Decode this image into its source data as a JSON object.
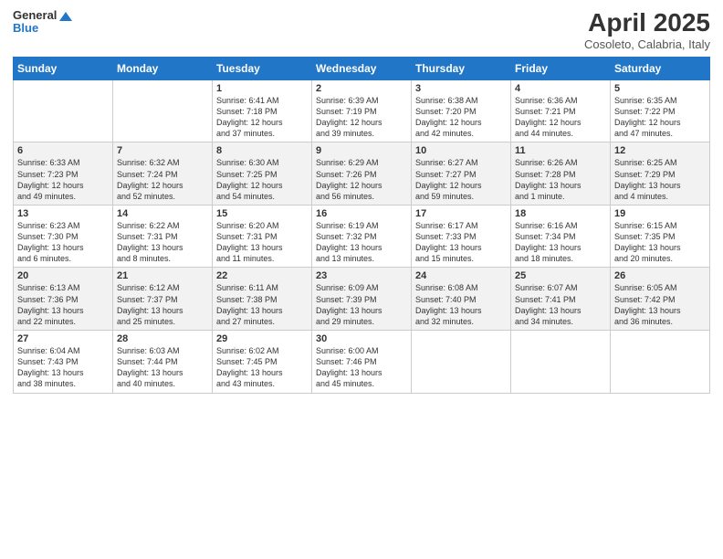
{
  "header": {
    "logo_line1": "General",
    "logo_line2": "Blue",
    "month": "April 2025",
    "location": "Cosoleto, Calabria, Italy"
  },
  "weekdays": [
    "Sunday",
    "Monday",
    "Tuesday",
    "Wednesday",
    "Thursday",
    "Friday",
    "Saturday"
  ],
  "weeks": [
    [
      {
        "day": "",
        "info": ""
      },
      {
        "day": "",
        "info": ""
      },
      {
        "day": "1",
        "info": "Sunrise: 6:41 AM\nSunset: 7:18 PM\nDaylight: 12 hours\nand 37 minutes."
      },
      {
        "day": "2",
        "info": "Sunrise: 6:39 AM\nSunset: 7:19 PM\nDaylight: 12 hours\nand 39 minutes."
      },
      {
        "day": "3",
        "info": "Sunrise: 6:38 AM\nSunset: 7:20 PM\nDaylight: 12 hours\nand 42 minutes."
      },
      {
        "day": "4",
        "info": "Sunrise: 6:36 AM\nSunset: 7:21 PM\nDaylight: 12 hours\nand 44 minutes."
      },
      {
        "day": "5",
        "info": "Sunrise: 6:35 AM\nSunset: 7:22 PM\nDaylight: 12 hours\nand 47 minutes."
      }
    ],
    [
      {
        "day": "6",
        "info": "Sunrise: 6:33 AM\nSunset: 7:23 PM\nDaylight: 12 hours\nand 49 minutes."
      },
      {
        "day": "7",
        "info": "Sunrise: 6:32 AM\nSunset: 7:24 PM\nDaylight: 12 hours\nand 52 minutes."
      },
      {
        "day": "8",
        "info": "Sunrise: 6:30 AM\nSunset: 7:25 PM\nDaylight: 12 hours\nand 54 minutes."
      },
      {
        "day": "9",
        "info": "Sunrise: 6:29 AM\nSunset: 7:26 PM\nDaylight: 12 hours\nand 56 minutes."
      },
      {
        "day": "10",
        "info": "Sunrise: 6:27 AM\nSunset: 7:27 PM\nDaylight: 12 hours\nand 59 minutes."
      },
      {
        "day": "11",
        "info": "Sunrise: 6:26 AM\nSunset: 7:28 PM\nDaylight: 13 hours\nand 1 minute."
      },
      {
        "day": "12",
        "info": "Sunrise: 6:25 AM\nSunset: 7:29 PM\nDaylight: 13 hours\nand 4 minutes."
      }
    ],
    [
      {
        "day": "13",
        "info": "Sunrise: 6:23 AM\nSunset: 7:30 PM\nDaylight: 13 hours\nand 6 minutes."
      },
      {
        "day": "14",
        "info": "Sunrise: 6:22 AM\nSunset: 7:31 PM\nDaylight: 13 hours\nand 8 minutes."
      },
      {
        "day": "15",
        "info": "Sunrise: 6:20 AM\nSunset: 7:31 PM\nDaylight: 13 hours\nand 11 minutes."
      },
      {
        "day": "16",
        "info": "Sunrise: 6:19 AM\nSunset: 7:32 PM\nDaylight: 13 hours\nand 13 minutes."
      },
      {
        "day": "17",
        "info": "Sunrise: 6:17 AM\nSunset: 7:33 PM\nDaylight: 13 hours\nand 15 minutes."
      },
      {
        "day": "18",
        "info": "Sunrise: 6:16 AM\nSunset: 7:34 PM\nDaylight: 13 hours\nand 18 minutes."
      },
      {
        "day": "19",
        "info": "Sunrise: 6:15 AM\nSunset: 7:35 PM\nDaylight: 13 hours\nand 20 minutes."
      }
    ],
    [
      {
        "day": "20",
        "info": "Sunrise: 6:13 AM\nSunset: 7:36 PM\nDaylight: 13 hours\nand 22 minutes."
      },
      {
        "day": "21",
        "info": "Sunrise: 6:12 AM\nSunset: 7:37 PM\nDaylight: 13 hours\nand 25 minutes."
      },
      {
        "day": "22",
        "info": "Sunrise: 6:11 AM\nSunset: 7:38 PM\nDaylight: 13 hours\nand 27 minutes."
      },
      {
        "day": "23",
        "info": "Sunrise: 6:09 AM\nSunset: 7:39 PM\nDaylight: 13 hours\nand 29 minutes."
      },
      {
        "day": "24",
        "info": "Sunrise: 6:08 AM\nSunset: 7:40 PM\nDaylight: 13 hours\nand 32 minutes."
      },
      {
        "day": "25",
        "info": "Sunrise: 6:07 AM\nSunset: 7:41 PM\nDaylight: 13 hours\nand 34 minutes."
      },
      {
        "day": "26",
        "info": "Sunrise: 6:05 AM\nSunset: 7:42 PM\nDaylight: 13 hours\nand 36 minutes."
      }
    ],
    [
      {
        "day": "27",
        "info": "Sunrise: 6:04 AM\nSunset: 7:43 PM\nDaylight: 13 hours\nand 38 minutes."
      },
      {
        "day": "28",
        "info": "Sunrise: 6:03 AM\nSunset: 7:44 PM\nDaylight: 13 hours\nand 40 minutes."
      },
      {
        "day": "29",
        "info": "Sunrise: 6:02 AM\nSunset: 7:45 PM\nDaylight: 13 hours\nand 43 minutes."
      },
      {
        "day": "30",
        "info": "Sunrise: 6:00 AM\nSunset: 7:46 PM\nDaylight: 13 hours\nand 45 minutes."
      },
      {
        "day": "",
        "info": ""
      },
      {
        "day": "",
        "info": ""
      },
      {
        "day": "",
        "info": ""
      }
    ]
  ]
}
